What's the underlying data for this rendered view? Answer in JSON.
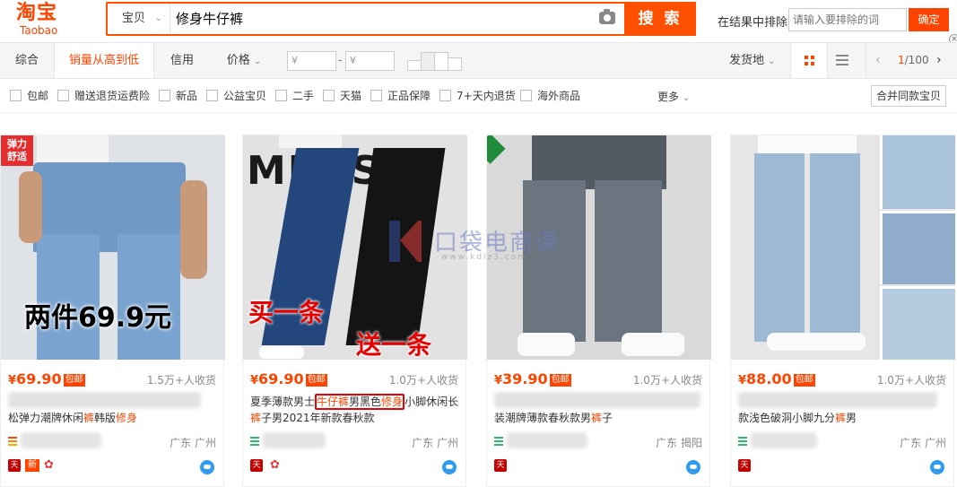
{
  "header": {
    "logo_cn": "淘宝",
    "logo_en": "Taobao",
    "scope": "宝贝",
    "query": "修身牛仔裤",
    "search_button": "搜 索",
    "exclude_label": "在结果中排除",
    "exclude_placeholder": "请输入要排除的词",
    "confirm": "确定"
  },
  "sortbar": {
    "tabs": [
      "综合",
      "销量从高到低",
      "信用",
      "价格"
    ],
    "price_min": "¥",
    "price_max": "¥",
    "dash": "-",
    "ship_from": "发货地",
    "page_current": "1",
    "page_total": "/100"
  },
  "filters": [
    "包邮",
    "赠送退货运费险",
    "新品",
    "公益宝贝",
    "二手",
    "天猫",
    "正品保障",
    "7+天内退货",
    "海外商品"
  ],
  "more": "更多",
  "merge": "合并同款宝贝",
  "watermark": "口袋电商课",
  "watermark_url": "www.kdiz3.com",
  "products": [
    {
      "price": "69.90",
      "currency": "¥",
      "freeship": "包邮",
      "sales": "1.5万+人收货",
      "title_plain": "松弹力潮牌休闲",
      "title_hl1": "裤",
      "title_mid": "韩版",
      "title_hl2": "修身",
      "location": "广东 广州",
      "badge": "弹力\n舒适",
      "promo": "两件69.9元",
      "tags": [
        "tmall",
        "新",
        "flower"
      ]
    },
    {
      "price": "69.90",
      "currency": "¥",
      "freeship": "包邮",
      "sales": "1.0万+人收货",
      "title_line1_a": "夏季薄款男士",
      "title_line1_hl": "牛仔裤",
      "title_line1_b": "男黑色",
      "title_line1_hl2": "修身",
      "title_line1_c": "小脚休闲长",
      "title_line2_hl": "裤",
      "title_line2": "子男2021年新款春秋款",
      "location": "广东 广州",
      "banner": "MENS",
      "promo1": "买一条",
      "promo2": "送一条",
      "tags": [
        "tmall",
        "flower"
      ]
    },
    {
      "price": "39.90",
      "currency": "¥",
      "freeship": "包邮",
      "sales": "1.0万+人收货",
      "title_plain": "装潮牌薄款春秋款男",
      "title_hl": "裤",
      "title_end": "子",
      "location": "广东 揭阳",
      "tags": [
        "tmall"
      ]
    },
    {
      "price": "88.00",
      "currency": "¥",
      "freeship": "包邮",
      "sales": "1.0万+人收货",
      "title_plain": "款浅色破洞小脚九分",
      "title_hl": "裤",
      "title_end": "男",
      "location": "广东 广州",
      "tags": [
        "tmall"
      ]
    }
  ],
  "colors": {
    "brand": "#ff4400",
    "search_border": "#ff5000",
    "tmall": "#c40000",
    "wangwang": "#2d9cf0"
  }
}
